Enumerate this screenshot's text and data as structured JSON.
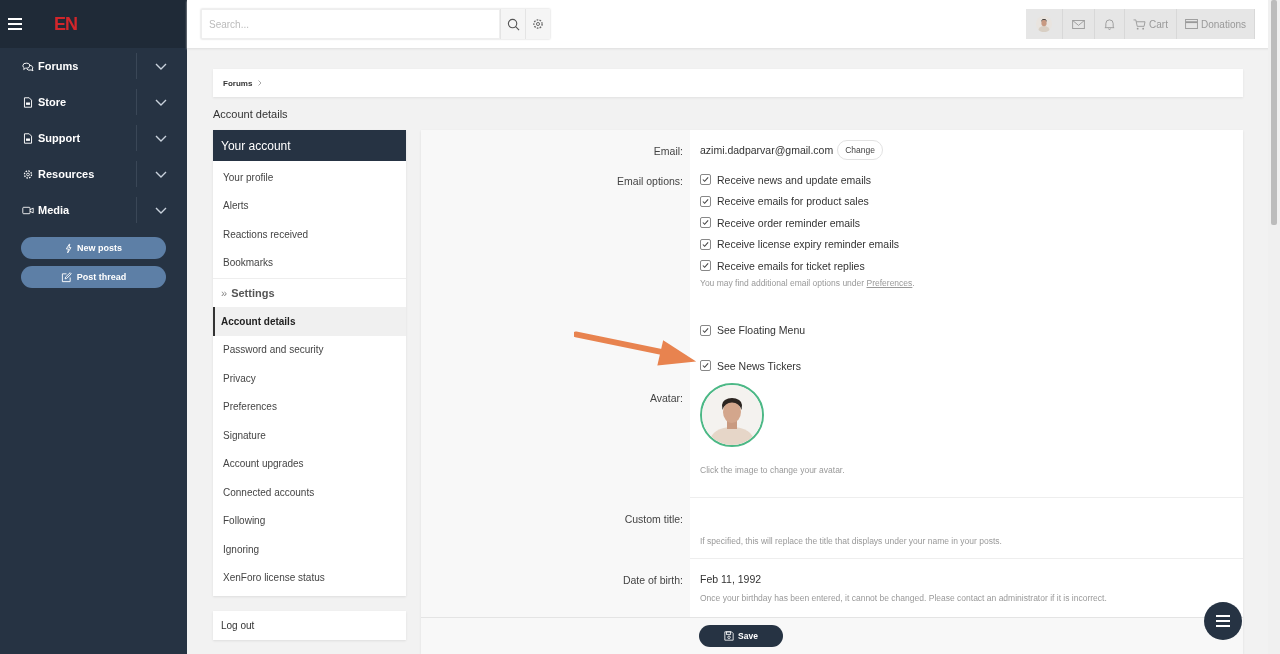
{
  "sidebar": {
    "logo": "EN",
    "nav": [
      {
        "label": "Forums"
      },
      {
        "label": "Store"
      },
      {
        "label": "Support"
      },
      {
        "label": "Resources"
      },
      {
        "label": "Media"
      }
    ],
    "buttons": [
      "New posts",
      "Post thread"
    ]
  },
  "header": {
    "search": {
      "placeholder": "Search..."
    },
    "cart": "Cart",
    "donations": "Donations"
  },
  "breadcrumb": [
    "Forums"
  ],
  "page_title": "Account details",
  "account_nav": {
    "title": "Your account",
    "items": [
      {
        "label": "Your profile",
        "selected": false
      },
      {
        "label": "Alerts",
        "selected": false
      },
      {
        "label": "Reactions received",
        "selected": false
      },
      {
        "label": "Bookmarks",
        "selected": false
      }
    ],
    "settings_marker": "»",
    "settings_title": "Settings",
    "settings_items": [
      {
        "label": "Account details",
        "selected": true
      },
      {
        "label": "Password and security",
        "selected": false
      },
      {
        "label": "Privacy",
        "selected": false
      },
      {
        "label": "Preferences",
        "selected": false
      },
      {
        "label": "Signature",
        "selected": false
      },
      {
        "label": "Account upgrades",
        "selected": false
      },
      {
        "label": "Connected accounts",
        "selected": false
      },
      {
        "label": "Following",
        "selected": false
      },
      {
        "label": "Ignoring",
        "selected": false
      },
      {
        "label": "XenForo license status",
        "selected": false
      }
    ],
    "logout": "Log out"
  },
  "form": {
    "email": {
      "label": "Email:",
      "value": "azimi.dadparvar@gmail.com",
      "button": "Change"
    },
    "email_options": {
      "label": "Email options:",
      "options": [
        {
          "label": "Receive news and update emails",
          "checked": true
        },
        {
          "label": "Receive emails for product sales",
          "checked": true
        },
        {
          "label": "Receive order reminder emails",
          "checked": true
        },
        {
          "label": "Receive license expiry reminder emails",
          "checked": true
        },
        {
          "label": "Receive emails for ticket replies",
          "checked": true
        }
      ],
      "hint": "You may find additional email options under ",
      "hint_link": "Preferences",
      "hint_end": "."
    },
    "extra_options": [
      {
        "label": "See Floating Menu",
        "checked": true
      },
      {
        "label": "See News Tickers",
        "checked": true
      }
    ],
    "avatar": {
      "label": "Avatar:",
      "hint": "Click the image to change your avatar."
    },
    "custom_title": {
      "label": "Custom title:",
      "hint": "If specified, this will replace the title that displays under your name in your posts."
    },
    "dob": {
      "label": "Date of birth:",
      "value": "Feb 11, 1992",
      "hint": "Once your birthday has been entered, it cannot be changed. Please contact an administrator if it is incorrect."
    },
    "save": "Save"
  }
}
